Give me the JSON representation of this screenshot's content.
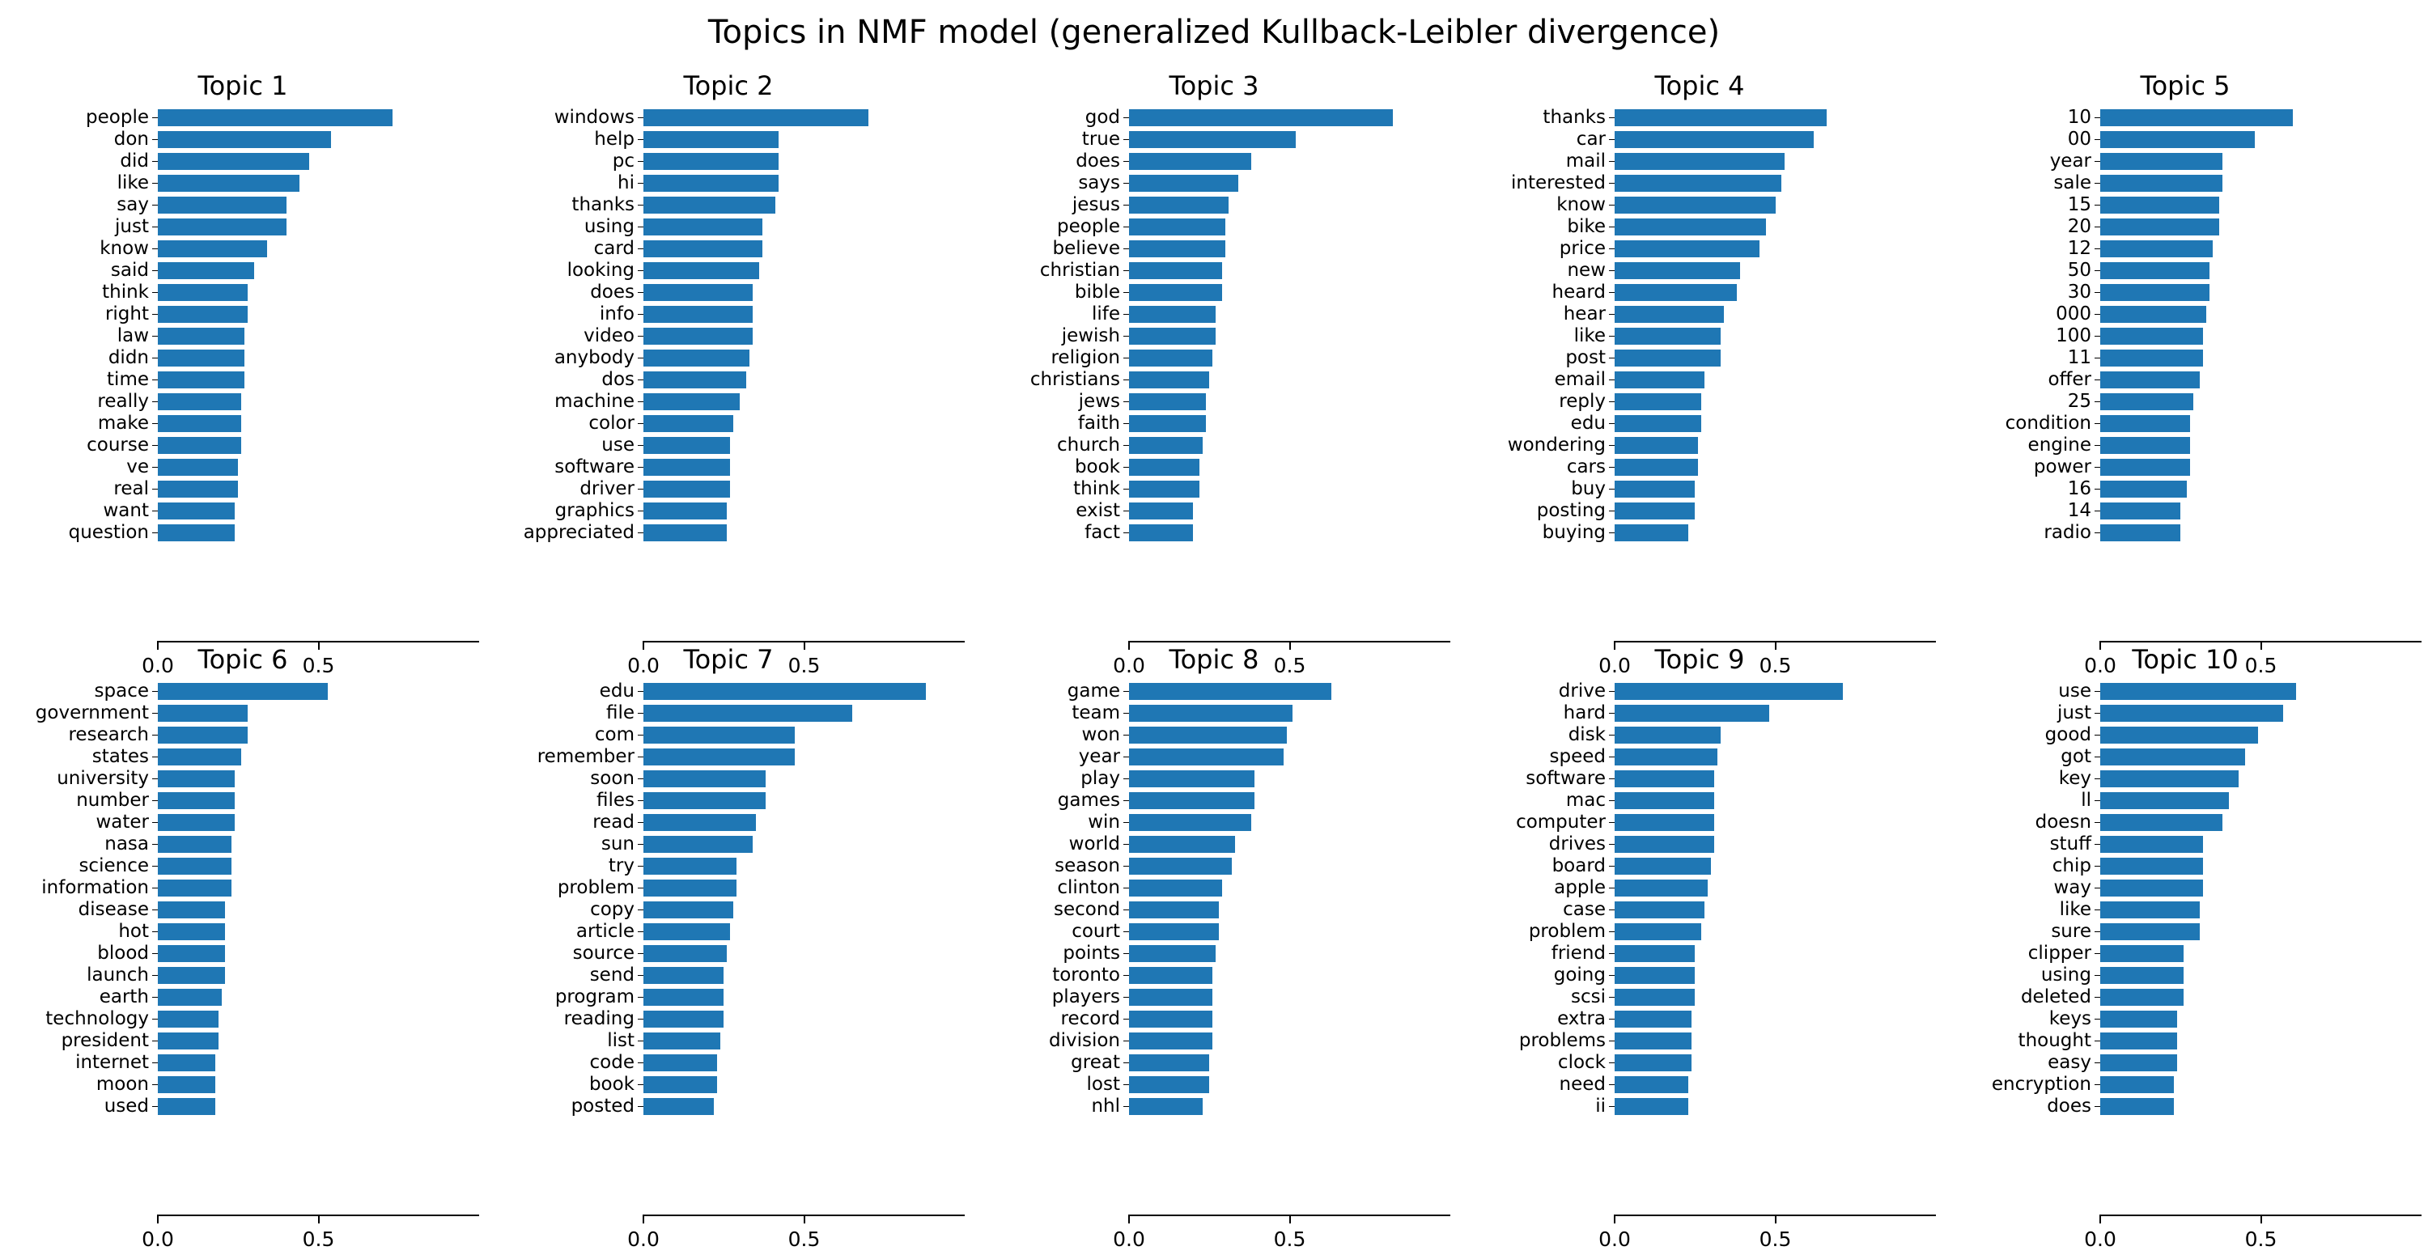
{
  "figure": {
    "suptitle": "Topics in NMF model (generalized Kullback-Leibler divergence)",
    "bar_color": "#1f77b4",
    "background": "#ffffff"
  },
  "chart_data": {
    "type": "bar",
    "orientation": "horizontal",
    "title": "Topics in NMF model (generalized Kullback-Leibler divergence)",
    "xlabel": "",
    "ylabel": "",
    "xticks": [
      "0.0",
      "0.5"
    ],
    "xtick_values": [
      0.0,
      0.5
    ],
    "xlim": [
      0.0,
      1.0
    ],
    "grid": false,
    "legend": null,
    "layout": {
      "rows": 2,
      "cols": 5
    },
    "panels": [
      {
        "title": "Topic 1",
        "categories": [
          "people",
          "don",
          "did",
          "like",
          "say",
          "just",
          "know",
          "said",
          "think",
          "right",
          "law",
          "didn",
          "time",
          "really",
          "make",
          "course",
          "ve",
          "real",
          "want",
          "question"
        ],
        "values": [
          0.73,
          0.54,
          0.47,
          0.44,
          0.4,
          0.4,
          0.34,
          0.3,
          0.28,
          0.28,
          0.27,
          0.27,
          0.27,
          0.26,
          0.26,
          0.26,
          0.25,
          0.25,
          0.24,
          0.24
        ]
      },
      {
        "title": "Topic 2",
        "categories": [
          "windows",
          "help",
          "pc",
          "hi",
          "thanks",
          "using",
          "card",
          "looking",
          "does",
          "info",
          "video",
          "anybody",
          "dos",
          "machine",
          "color",
          "use",
          "software",
          "driver",
          "graphics",
          "appreciated"
        ],
        "values": [
          0.7,
          0.42,
          0.42,
          0.42,
          0.41,
          0.37,
          0.37,
          0.36,
          0.34,
          0.34,
          0.34,
          0.33,
          0.32,
          0.3,
          0.28,
          0.27,
          0.27,
          0.27,
          0.26,
          0.26
        ]
      },
      {
        "title": "Topic 3",
        "categories": [
          "god",
          "true",
          "does",
          "says",
          "jesus",
          "people",
          "believe",
          "christian",
          "bible",
          "life",
          "jewish",
          "religion",
          "christians",
          "jews",
          "faith",
          "church",
          "book",
          "think",
          "exist",
          "fact"
        ],
        "values": [
          0.82,
          0.52,
          0.38,
          0.34,
          0.31,
          0.3,
          0.3,
          0.29,
          0.29,
          0.27,
          0.27,
          0.26,
          0.25,
          0.24,
          0.24,
          0.23,
          0.22,
          0.22,
          0.2,
          0.2
        ]
      },
      {
        "title": "Topic 4",
        "categories": [
          "thanks",
          "car",
          "mail",
          "interested",
          "know",
          "bike",
          "price",
          "new",
          "heard",
          "hear",
          "like",
          "post",
          "email",
          "reply",
          "edu",
          "wondering",
          "cars",
          "buy",
          "posting",
          "buying"
        ],
        "values": [
          0.66,
          0.62,
          0.53,
          0.52,
          0.5,
          0.47,
          0.45,
          0.39,
          0.38,
          0.34,
          0.33,
          0.33,
          0.28,
          0.27,
          0.27,
          0.26,
          0.26,
          0.25,
          0.25,
          0.23
        ]
      },
      {
        "title": "Topic 5",
        "categories": [
          "10",
          "00",
          "year",
          "sale",
          "15",
          "20",
          "12",
          "50",
          "30",
          "000",
          "100",
          "11",
          "offer",
          "25",
          "condition",
          "engine",
          "power",
          "16",
          "14",
          "radio"
        ],
        "values": [
          0.6,
          0.48,
          0.38,
          0.38,
          0.37,
          0.37,
          0.35,
          0.34,
          0.34,
          0.33,
          0.32,
          0.32,
          0.31,
          0.29,
          0.28,
          0.28,
          0.28,
          0.27,
          0.25,
          0.25
        ]
      },
      {
        "title": "Topic 6",
        "categories": [
          "space",
          "government",
          "research",
          "states",
          "university",
          "number",
          "water",
          "nasa",
          "science",
          "information",
          "disease",
          "hot",
          "blood",
          "launch",
          "earth",
          "technology",
          "president",
          "internet",
          "moon",
          "used"
        ],
        "values": [
          0.53,
          0.28,
          0.28,
          0.26,
          0.24,
          0.24,
          0.24,
          0.23,
          0.23,
          0.23,
          0.21,
          0.21,
          0.21,
          0.21,
          0.2,
          0.19,
          0.19,
          0.18,
          0.18,
          0.18
        ]
      },
      {
        "title": "Topic 7",
        "categories": [
          "edu",
          "file",
          "com",
          "remember",
          "soon",
          "files",
          "read",
          "sun",
          "try",
          "problem",
          "copy",
          "article",
          "source",
          "send",
          "program",
          "reading",
          "list",
          "code",
          "book",
          "posted"
        ],
        "values": [
          0.88,
          0.65,
          0.47,
          0.47,
          0.38,
          0.38,
          0.35,
          0.34,
          0.29,
          0.29,
          0.28,
          0.27,
          0.26,
          0.25,
          0.25,
          0.25,
          0.24,
          0.23,
          0.23,
          0.22
        ]
      },
      {
        "title": "Topic 8",
        "categories": [
          "game",
          "team",
          "won",
          "year",
          "play",
          "games",
          "win",
          "world",
          "season",
          "clinton",
          "second",
          "court",
          "points",
          "toronto",
          "players",
          "record",
          "division",
          "great",
          "lost",
          "nhl"
        ],
        "values": [
          0.63,
          0.51,
          0.49,
          0.48,
          0.39,
          0.39,
          0.38,
          0.33,
          0.32,
          0.29,
          0.28,
          0.28,
          0.27,
          0.26,
          0.26,
          0.26,
          0.26,
          0.25,
          0.25,
          0.23
        ]
      },
      {
        "title": "Topic 9",
        "categories": [
          "drive",
          "hard",
          "disk",
          "speed",
          "software",
          "mac",
          "computer",
          "drives",
          "board",
          "apple",
          "case",
          "problem",
          "friend",
          "going",
          "scsi",
          "extra",
          "problems",
          "clock",
          "need",
          "ii"
        ],
        "values": [
          0.71,
          0.48,
          0.33,
          0.32,
          0.31,
          0.31,
          0.31,
          0.31,
          0.3,
          0.29,
          0.28,
          0.27,
          0.25,
          0.25,
          0.25,
          0.24,
          0.24,
          0.24,
          0.23,
          0.23
        ]
      },
      {
        "title": "Topic 10",
        "categories": [
          "use",
          "just",
          "good",
          "got",
          "key",
          "ll",
          "doesn",
          "stuff",
          "chip",
          "way",
          "like",
          "sure",
          "clipper",
          "using",
          "deleted",
          "keys",
          "thought",
          "easy",
          "encryption",
          "does"
        ],
        "values": [
          0.61,
          0.57,
          0.49,
          0.45,
          0.43,
          0.4,
          0.38,
          0.32,
          0.32,
          0.32,
          0.31,
          0.31,
          0.26,
          0.26,
          0.26,
          0.24,
          0.24,
          0.24,
          0.23,
          0.23
        ]
      }
    ]
  }
}
